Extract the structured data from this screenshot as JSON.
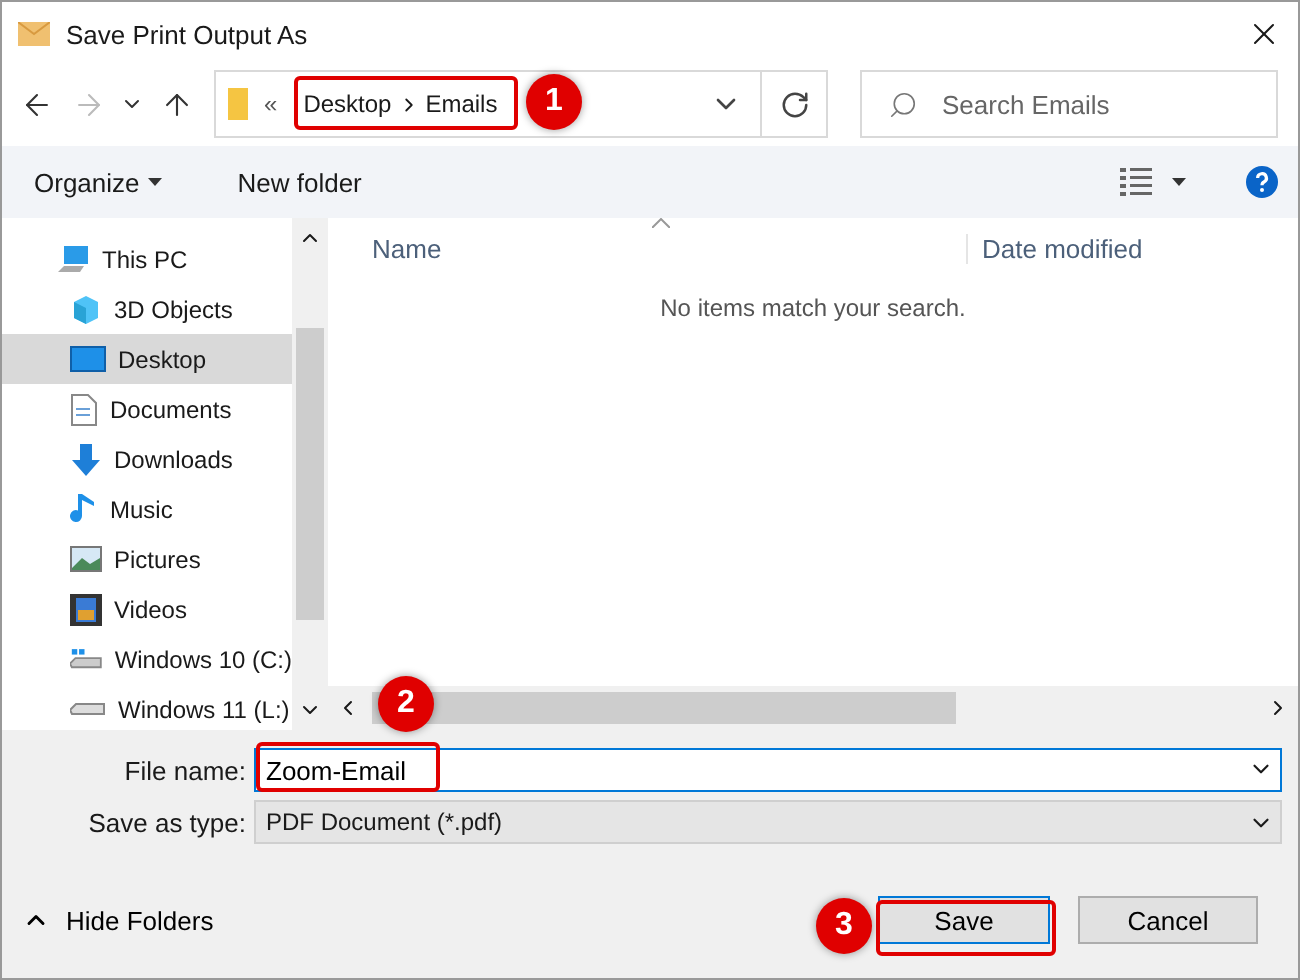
{
  "window": {
    "title": "Save Print Output As"
  },
  "address": {
    "overflow": "«",
    "path": [
      "Desktop",
      "Emails"
    ]
  },
  "search": {
    "placeholder": "Search Emails"
  },
  "toolbar": {
    "organize": "Organize",
    "new_folder": "New folder"
  },
  "sidebar": {
    "items": [
      {
        "label": "This PC",
        "selected": false,
        "children": [
          {
            "label": "3D Objects",
            "selected": false
          },
          {
            "label": "Desktop",
            "selected": true
          },
          {
            "label": "Documents",
            "selected": false
          },
          {
            "label": "Downloads",
            "selected": false
          },
          {
            "label": "Music",
            "selected": false
          },
          {
            "label": "Pictures",
            "selected": false
          },
          {
            "label": "Videos",
            "selected": false
          },
          {
            "label": "Windows 10 (C:)",
            "selected": false
          },
          {
            "label": "Windows 11 (L:)",
            "selected": false
          }
        ]
      }
    ]
  },
  "file_list": {
    "columns": [
      "Name",
      "Date modified"
    ],
    "empty_message": "No items match your search."
  },
  "form": {
    "file_name_label": "File name:",
    "file_name": "Zoom-Email",
    "type_label": "Save as type:",
    "type": "PDF Document (*.pdf)"
  },
  "hide_folders": "Hide Folders",
  "buttons": [
    {
      "label": "Save",
      "default": true
    },
    {
      "label": "Cancel",
      "default": false
    }
  ],
  "callouts": [
    "1",
    "2",
    "3"
  ]
}
